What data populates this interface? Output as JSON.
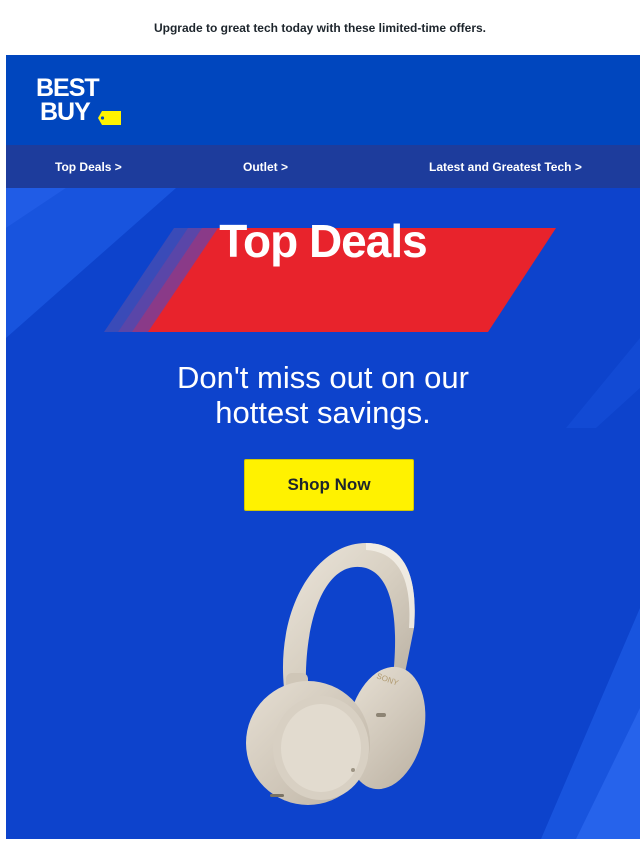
{
  "preheader": "Upgrade to great tech today with these limited-time offers.",
  "brand": {
    "name": "Best Buy",
    "logo_line1": "BEST",
    "logo_line2": "BUY",
    "logo_mark": "™",
    "tag_color": "#fff200"
  },
  "nav": {
    "items": [
      {
        "label": "Top Deals >"
      },
      {
        "label": "Outlet >"
      },
      {
        "label": "Latest and Greatest Tech >"
      }
    ]
  },
  "hero": {
    "banner_title": "Top Deals",
    "headline_line1": "Don't miss out on our",
    "headline_line2": "hottest savings.",
    "cta_label": "Shop Now",
    "product_image": "headphones-image",
    "product_brand": "SONY"
  },
  "colors": {
    "header_blue": "#0046be",
    "nav_blue": "#1d3c9c",
    "hero_blue": "#0d43cc",
    "banner_red": "#e8232c",
    "cta_yellow": "#fff200"
  }
}
